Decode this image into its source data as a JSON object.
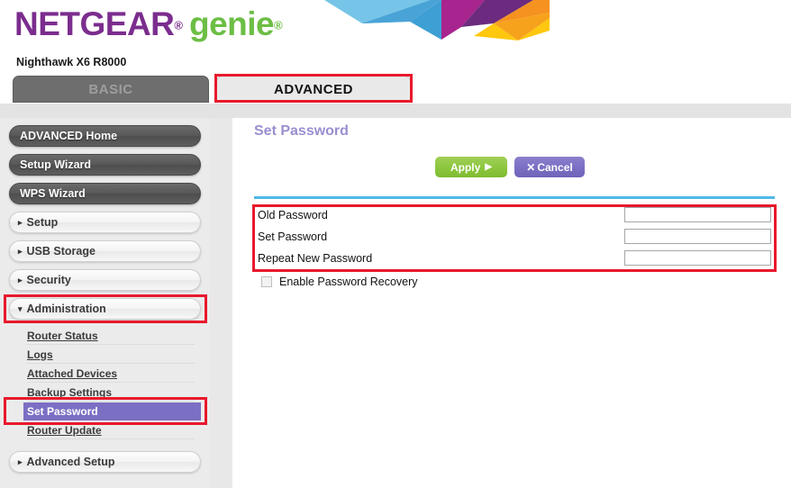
{
  "header": {
    "brand_primary": "NETGEAR",
    "brand_secondary": "genie",
    "reg_mark": "®",
    "model": "Nighthawk X6 R8000"
  },
  "tabs": [
    {
      "label": "BASIC",
      "active": false
    },
    {
      "label": "ADVANCED",
      "active": true
    }
  ],
  "sidebar": {
    "primary": [
      {
        "label": "ADVANCED Home",
        "style": "dark"
      },
      {
        "label": "Setup Wizard",
        "style": "dark"
      },
      {
        "label": "WPS Wizard",
        "style": "dark"
      },
      {
        "label": "Setup",
        "style": "light",
        "caret": "▸"
      },
      {
        "label": "USB Storage",
        "style": "light",
        "caret": "▸"
      },
      {
        "label": "Security",
        "style": "light",
        "caret": "▸"
      },
      {
        "label": "Administration",
        "style": "light",
        "caret": "▾",
        "highlighted": true
      }
    ],
    "submenu": [
      {
        "label": "Router Status",
        "selected": false
      },
      {
        "label": "Logs",
        "selected": false
      },
      {
        "label": "Attached Devices",
        "selected": false
      },
      {
        "label": "Backup Settings",
        "selected": false
      },
      {
        "label": "Set Password",
        "selected": true
      },
      {
        "label": "Router Update",
        "selected": false
      }
    ],
    "footer_item": {
      "label": "Advanced Setup",
      "caret": "▸"
    }
  },
  "main": {
    "title": "Set Password",
    "buttons": {
      "apply": "Apply",
      "apply_arrow": "▶",
      "cancel": "Cancel",
      "cancel_mark": "✕"
    },
    "fields": [
      {
        "label": "Old Password",
        "value": "",
        "placeholder": ""
      },
      {
        "label": "Set Password",
        "value": "",
        "placeholder": ""
      },
      {
        "label": "Repeat New Password",
        "value": "",
        "placeholder": ""
      }
    ],
    "checkbox": {
      "label": "Enable Password Recovery",
      "checked": false
    }
  },
  "colors": {
    "brand_purple": "#7b2d8e",
    "brand_green": "#6cbe45",
    "accent_cyan": "#4db8e8",
    "apply_green": "#8cc63e",
    "cancel_purple": "#7b6fc4",
    "selected_purple": "#7b6fc4",
    "annotation_red": "#e8192c",
    "title_purple": "#9a8fd0"
  }
}
